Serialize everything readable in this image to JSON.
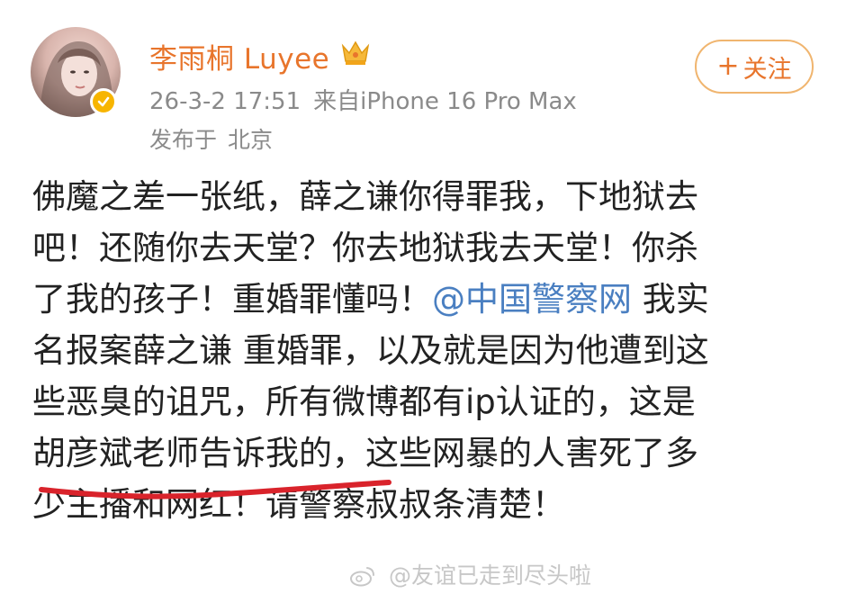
{
  "header": {
    "username": "李雨桐 Luyee",
    "badge_icon": "crown-icon",
    "verified_icon": "verified-check-icon",
    "timestamp": "26-3-2 17:51",
    "source": "来自iPhone 16 Pro Max",
    "location_prefix": "发布于",
    "location": "北京",
    "follow_label": "关注",
    "follow_symbol": "+"
  },
  "post": {
    "lines": [
      {
        "text": "佛魔之差一张纸，薛之谦你得罪我，下地狱去"
      },
      {
        "text": "吧！还随你去天堂？你去地狱我去天堂！你杀"
      },
      {
        "pre": "了我的孩子！重婚罪懂吗！",
        "mention": "@中国警察网",
        "post": " 我实"
      },
      {
        "text": "名报案薛之谦 重婚罪，以及就是因为他遭到这"
      },
      {
        "text": "些恶臭的诅咒，所有微博都有ip认证的，这是"
      },
      {
        "text": "胡彦斌老师告诉我的，这些网暴的人害死了多"
      },
      {
        "text": "少主播和网红！请警察叔叔条清楚！"
      }
    ]
  },
  "watermark": {
    "text": "@友谊已走到尽头啦"
  },
  "colors": {
    "username": "#e8752c",
    "mention": "#4a7fc1",
    "annotation": "#d9232b",
    "meta": "#8a8a8a"
  }
}
